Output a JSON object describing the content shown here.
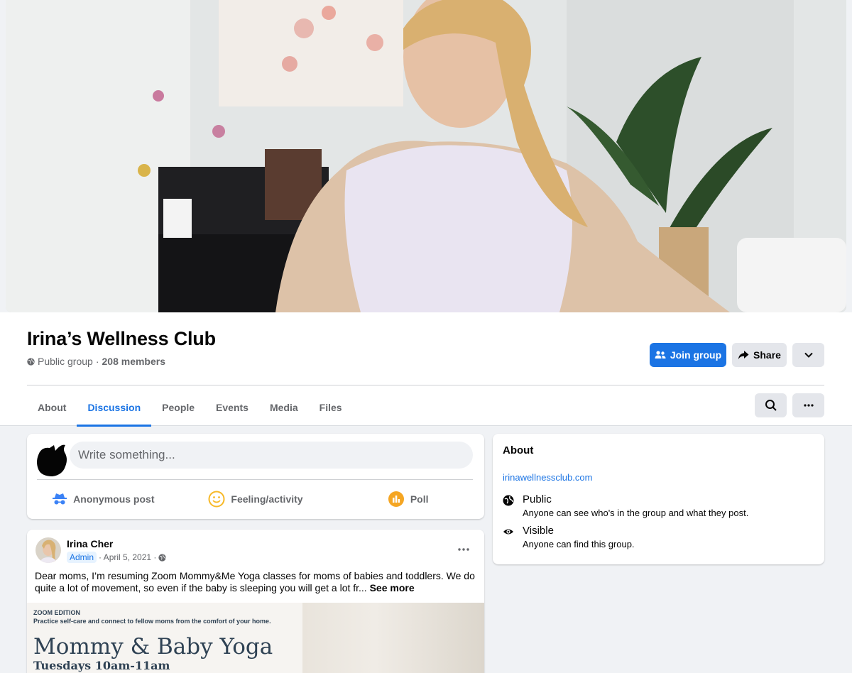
{
  "group": {
    "name": "Irina’s Wellness Club",
    "privacy": "Public group",
    "separator": "·",
    "members": "208 members"
  },
  "header_actions": {
    "join_label": "Join group",
    "share_label": "Share"
  },
  "tabs": [
    {
      "label": "About"
    },
    {
      "label": "Discussion",
      "active": true
    },
    {
      "label": "People"
    },
    {
      "label": "Events"
    },
    {
      "label": "Media"
    },
    {
      "label": "Files"
    }
  ],
  "composer": {
    "placeholder": "Write something...",
    "actions": [
      {
        "label": "Anonymous post",
        "icon": "anonymous-icon"
      },
      {
        "label": "Feeling/activity",
        "icon": "smiley-icon"
      },
      {
        "label": "Poll",
        "icon": "poll-icon"
      }
    ]
  },
  "post": {
    "author": "Irina Cher",
    "badge": "Admin",
    "date": "· April 5, 2021 ·",
    "text": "Dear moms, I’m resuming Zoom Mommy&Me Yoga classes for moms of babies and toddlers. We do quite a lot of movement, so even if the baby is sleeping you will get a lot fr...",
    "see_more": "See more",
    "image": {
      "edition": "ZOOM EDITION",
      "subtitle": "Practice self-care and connect to fellow moms from the comfort of your home.",
      "title": "Mommy & Baby Yoga",
      "schedule": "Tuesdays 10am-11am"
    }
  },
  "about": {
    "heading": "About",
    "link": "irinawellnessclub.com",
    "items": [
      {
        "title": "Public",
        "desc": "Anyone can see who's in the group and what they post.",
        "icon": "globe-icon"
      },
      {
        "title": "Visible",
        "desc": "Anyone can find this group.",
        "icon": "eye-icon"
      }
    ]
  },
  "colors": {
    "accent": "#1b74e4",
    "page_bg": "#f0f2f5",
    "secondary_btn": "#e4e6eb"
  }
}
